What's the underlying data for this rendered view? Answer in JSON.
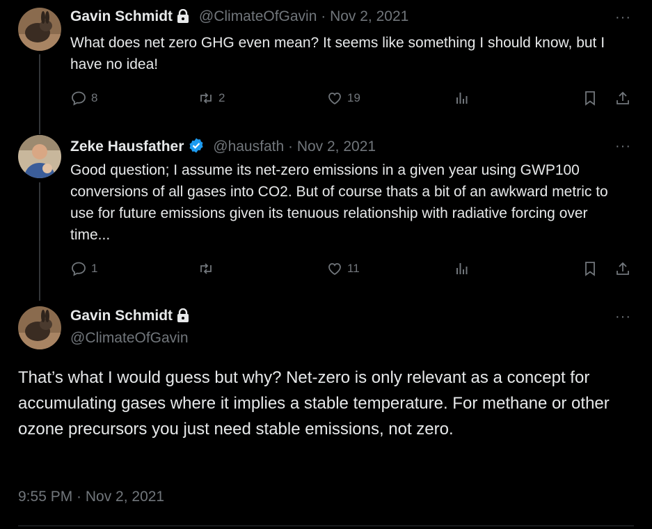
{
  "tweets": [
    {
      "name": "Gavin Schmidt",
      "handle": "@ClimateOfGavin",
      "date": "Nov 2, 2021",
      "text": "What does net zero GHG even mean? It seems like something I should know, but I have no idea!",
      "replies": "8",
      "retweets": "2",
      "likes": "19",
      "locked": true
    },
    {
      "name": "Zeke Hausfather",
      "handle": "@hausfath",
      "date": "Nov 2, 2021",
      "text": "Good question; I assume its net-zero emissions in a given year using GWP100 conversions of all gases into CO2. But of course thats a bit of an awkward metric to use for future emissions given its tenuous relationship with radiative forcing over time...",
      "replies": "1",
      "retweets": "",
      "likes": "11",
      "verified": true
    }
  ],
  "main_tweet": {
    "name": "Gavin Schmidt",
    "handle": "@ClimateOfGavin",
    "text": "That’s what I would guess but why? Net-zero is only relevant as a concept for accumulating gases where it implies a stable temperature. For methane or other ozone precursors you just need stable emissions, not zero.",
    "timestamp": "9:55 PM · Nov 2, 2021"
  },
  "ui": {
    "separator": " · ",
    "more": "···"
  },
  "colors": {
    "background": "#000000",
    "text": "#e7e9ea",
    "muted": "#71767b",
    "verified": "#1d9bf0"
  }
}
